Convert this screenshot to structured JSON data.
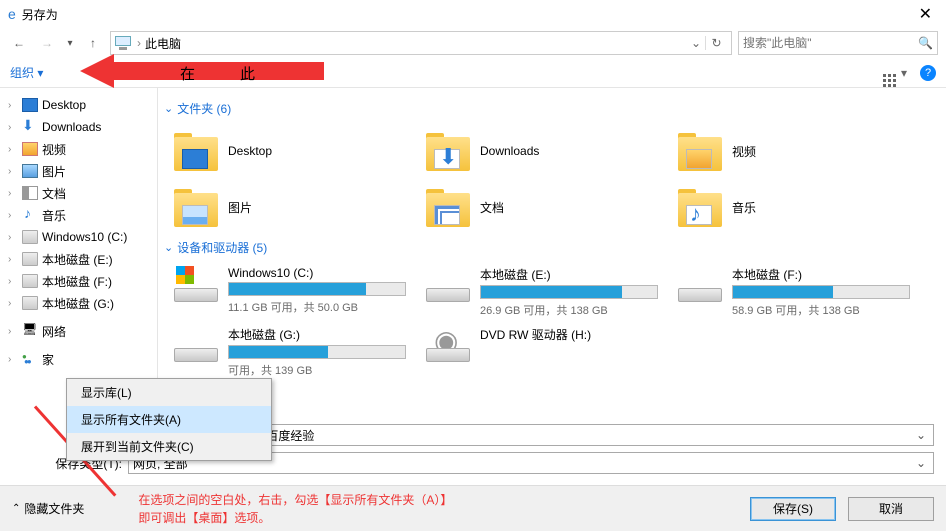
{
  "window": {
    "title": "另存为",
    "close": "✕"
  },
  "nav": {
    "back": "←",
    "fwd": "→",
    "recent": "▾",
    "up": "↑",
    "crumb": "此电脑",
    "drop": "⌄",
    "refresh": "↻",
    "search_ph": "搜索\"此电脑\"",
    "mag": "🔍"
  },
  "toolbar": {
    "organize": "组织 ▾",
    "view_drop": "▾",
    "help": "?",
    "annot1": "在",
    "annot2": "此"
  },
  "tree": [
    {
      "label": "Desktop",
      "icon": "i-desk"
    },
    {
      "label": "Downloads",
      "icon": "i-dl"
    },
    {
      "label": "视频",
      "icon": "i-vid"
    },
    {
      "label": "图片",
      "icon": "i-pic"
    },
    {
      "label": "文档",
      "icon": "i-doc"
    },
    {
      "label": "音乐",
      "icon": "i-mus"
    },
    {
      "label": "Windows10 (C:)",
      "icon": "i-dsk"
    },
    {
      "label": "本地磁盘 (E:)",
      "icon": "i-dsk"
    },
    {
      "label": "本地磁盘 (F:)",
      "icon": "i-dsk"
    },
    {
      "label": "本地磁盘 (G:)",
      "icon": "i-dsk"
    },
    {
      "label": "网络",
      "icon": "i-net",
      "gap": true
    },
    {
      "label": "家",
      "icon": "i-home",
      "gap": true
    }
  ],
  "sections": {
    "folders_hdr": "文件夹 (6)",
    "drives_hdr": "设备和驱动器 (5)"
  },
  "folders": [
    {
      "label": "Desktop",
      "ovl": "ovl-desk"
    },
    {
      "label": "Downloads",
      "ovl": "ovl-dl"
    },
    {
      "label": "视频",
      "ovl": "ovl-vid"
    },
    {
      "label": "图片",
      "ovl": "ovl-pic"
    },
    {
      "label": "文档",
      "ovl": "ovl-doc"
    },
    {
      "label": "音乐",
      "ovl": "ovl-mus"
    }
  ],
  "drives": [
    {
      "name": "Windows10 (C:)",
      "free": "11.1 GB 可用，共 50.0 GB",
      "fill": 78,
      "icon": "win"
    },
    {
      "name": "本地磁盘 (E:)",
      "free": "26.9 GB 可用，共 138 GB",
      "fill": 80,
      "icon": ""
    },
    {
      "name": "本地磁盘 (F:)",
      "free": "58.9 GB 可用，共 138 GB",
      "fill": 57,
      "icon": ""
    },
    {
      "name": "本地磁盘 (G:)",
      "free": "可用，共 139 GB",
      "fill": 56,
      "icon": ""
    },
    {
      "name": "DVD RW 驱动器 (H:)",
      "free": "",
      "fill": -1,
      "icon": "dvd"
    }
  ],
  "context_menu": [
    "显示库(L)",
    "显示所有文件夹(A)",
    "展开到当前文件夹(C)"
  ],
  "fields": {
    "filename_label": "",
    "filename_value": "面解决办法_笔记本电脑_百度经验",
    "filetype_label": "保存类型(T):",
    "filetype_value": "网页, 全部"
  },
  "footer": {
    "hide": "隐藏文件夹",
    "note_l1": "在选项之间的空白处，右击，勾选【显示所有文件夹（A）】",
    "note_l2": "即可调出【桌面】选项。",
    "save": "保存(S)",
    "cancel": "取消"
  }
}
